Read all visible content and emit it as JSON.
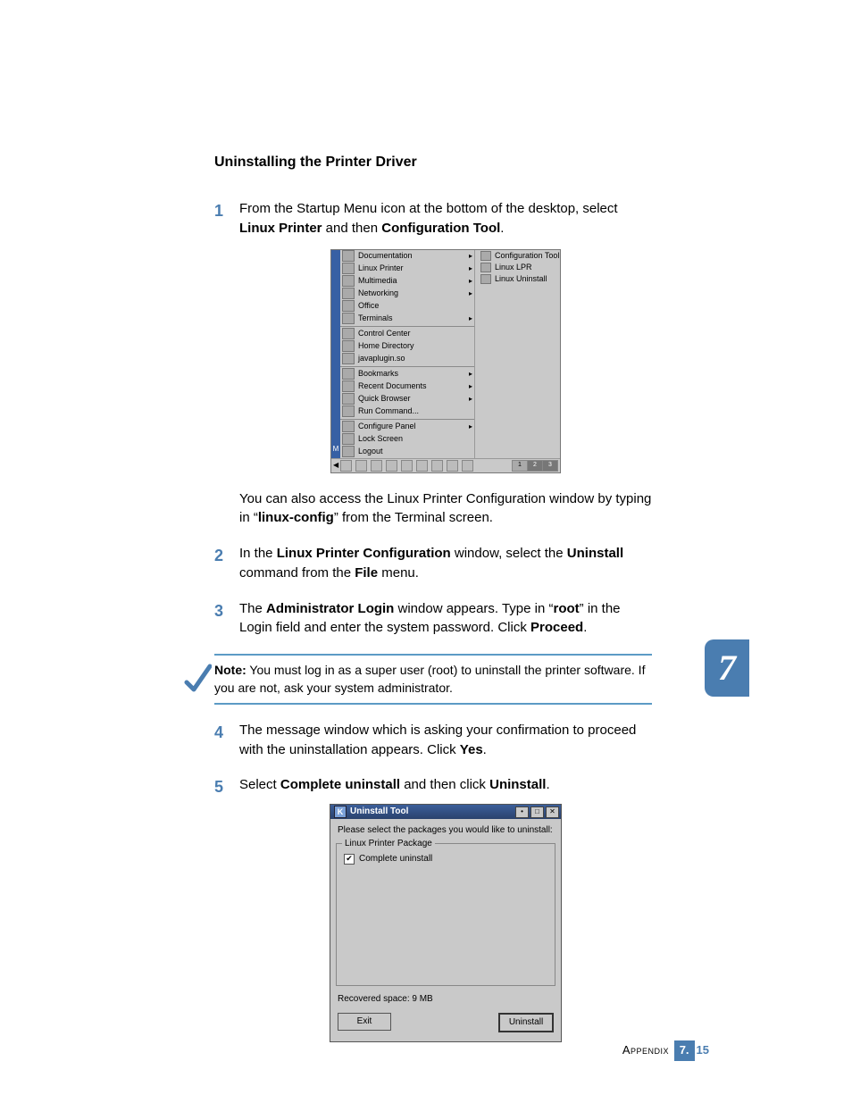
{
  "section_title": "Uninstalling the Printer Driver",
  "steps": {
    "s1_a": "From the Startup Menu icon at the bottom of the desktop, select ",
    "s1_b": "Linux Printer",
    "s1_c": " and then ",
    "s1_d": "Configuration Tool",
    "s1_e": ".",
    "s1_follow_a": "You can also access the Linux Printer Configuration window by typing in “",
    "s1_follow_b": "linux-config",
    "s1_follow_c": "” from the Terminal screen.",
    "s2_a": "In the ",
    "s2_b": "Linux Printer Configuration",
    "s2_c": " window, select the ",
    "s2_d": "Uninstall",
    "s2_e": " command from the ",
    "s2_f": "File",
    "s2_g": " menu.",
    "s3_a": "The ",
    "s3_b": "Administrator Login",
    "s3_c": " window appears. Type in “",
    "s3_d": "root",
    "s3_e": "” in the Login field and enter the system password. Click ",
    "s3_f": "Proceed",
    "s3_g": ".",
    "s4_a": "The message window which is asking your confirmation to proceed with the uninstallation appears. Click ",
    "s4_b": "Yes",
    "s4_c": ".",
    "s5_a": "Select ",
    "s5_b": "Complete uninstall",
    "s5_c": " and then click ",
    "s5_d": "Uninstall",
    "s5_e": "."
  },
  "step_numbers": {
    "n1": "1",
    "n2": "2",
    "n3": "3",
    "n4": "4",
    "n5": "5"
  },
  "note": {
    "label": "Note:",
    "text": " You must log in as a super user (root) to uninstall the printer software. If you are not, ask your system administrator."
  },
  "side_tab": "7",
  "footer": {
    "label": "Appendix",
    "chapter": "7.",
    "page": "15"
  },
  "kmenu": {
    "side_letter": "M",
    "items": [
      {
        "label": "Documentation",
        "arrow": true
      },
      {
        "label": "Linux Printer",
        "arrow": true
      },
      {
        "label": "Multimedia",
        "arrow": true
      },
      {
        "label": "Networking",
        "arrow": true
      },
      {
        "label": "Office",
        "arrow": false
      },
      {
        "label": "Terminals",
        "arrow": true
      },
      {
        "label": "Control Center",
        "arrow": false
      },
      {
        "label": "Home Directory",
        "arrow": false
      },
      {
        "label": "javaplugin.so",
        "arrow": false
      },
      {
        "label": "Bookmarks",
        "arrow": true
      },
      {
        "label": "Recent Documents",
        "arrow": true
      },
      {
        "label": "Quick Browser",
        "arrow": true
      },
      {
        "label": "Run Command...",
        "arrow": false
      },
      {
        "label": "Configure Panel",
        "arrow": true
      },
      {
        "label": "Lock Screen",
        "arrow": false
      },
      {
        "label": "Logout",
        "arrow": false
      }
    ],
    "submenu": [
      "Configuration Tool",
      "Linux LPR",
      "Linux Uninstall"
    ],
    "pager": [
      "1",
      "2",
      "3"
    ]
  },
  "dialog": {
    "title": "Uninstall Tool",
    "title_icon": "K",
    "prompt": "Please select the packages you would like to uninstall:",
    "frame_label": "Linux Printer Package",
    "check_label": "Complete uninstall",
    "check_mark": "✔",
    "recovered": "Recovered space:  9 MB",
    "btn_exit": "Exit",
    "btn_uninstall": "Uninstall",
    "win_min": "•",
    "win_max": "□",
    "win_close": "✕"
  }
}
